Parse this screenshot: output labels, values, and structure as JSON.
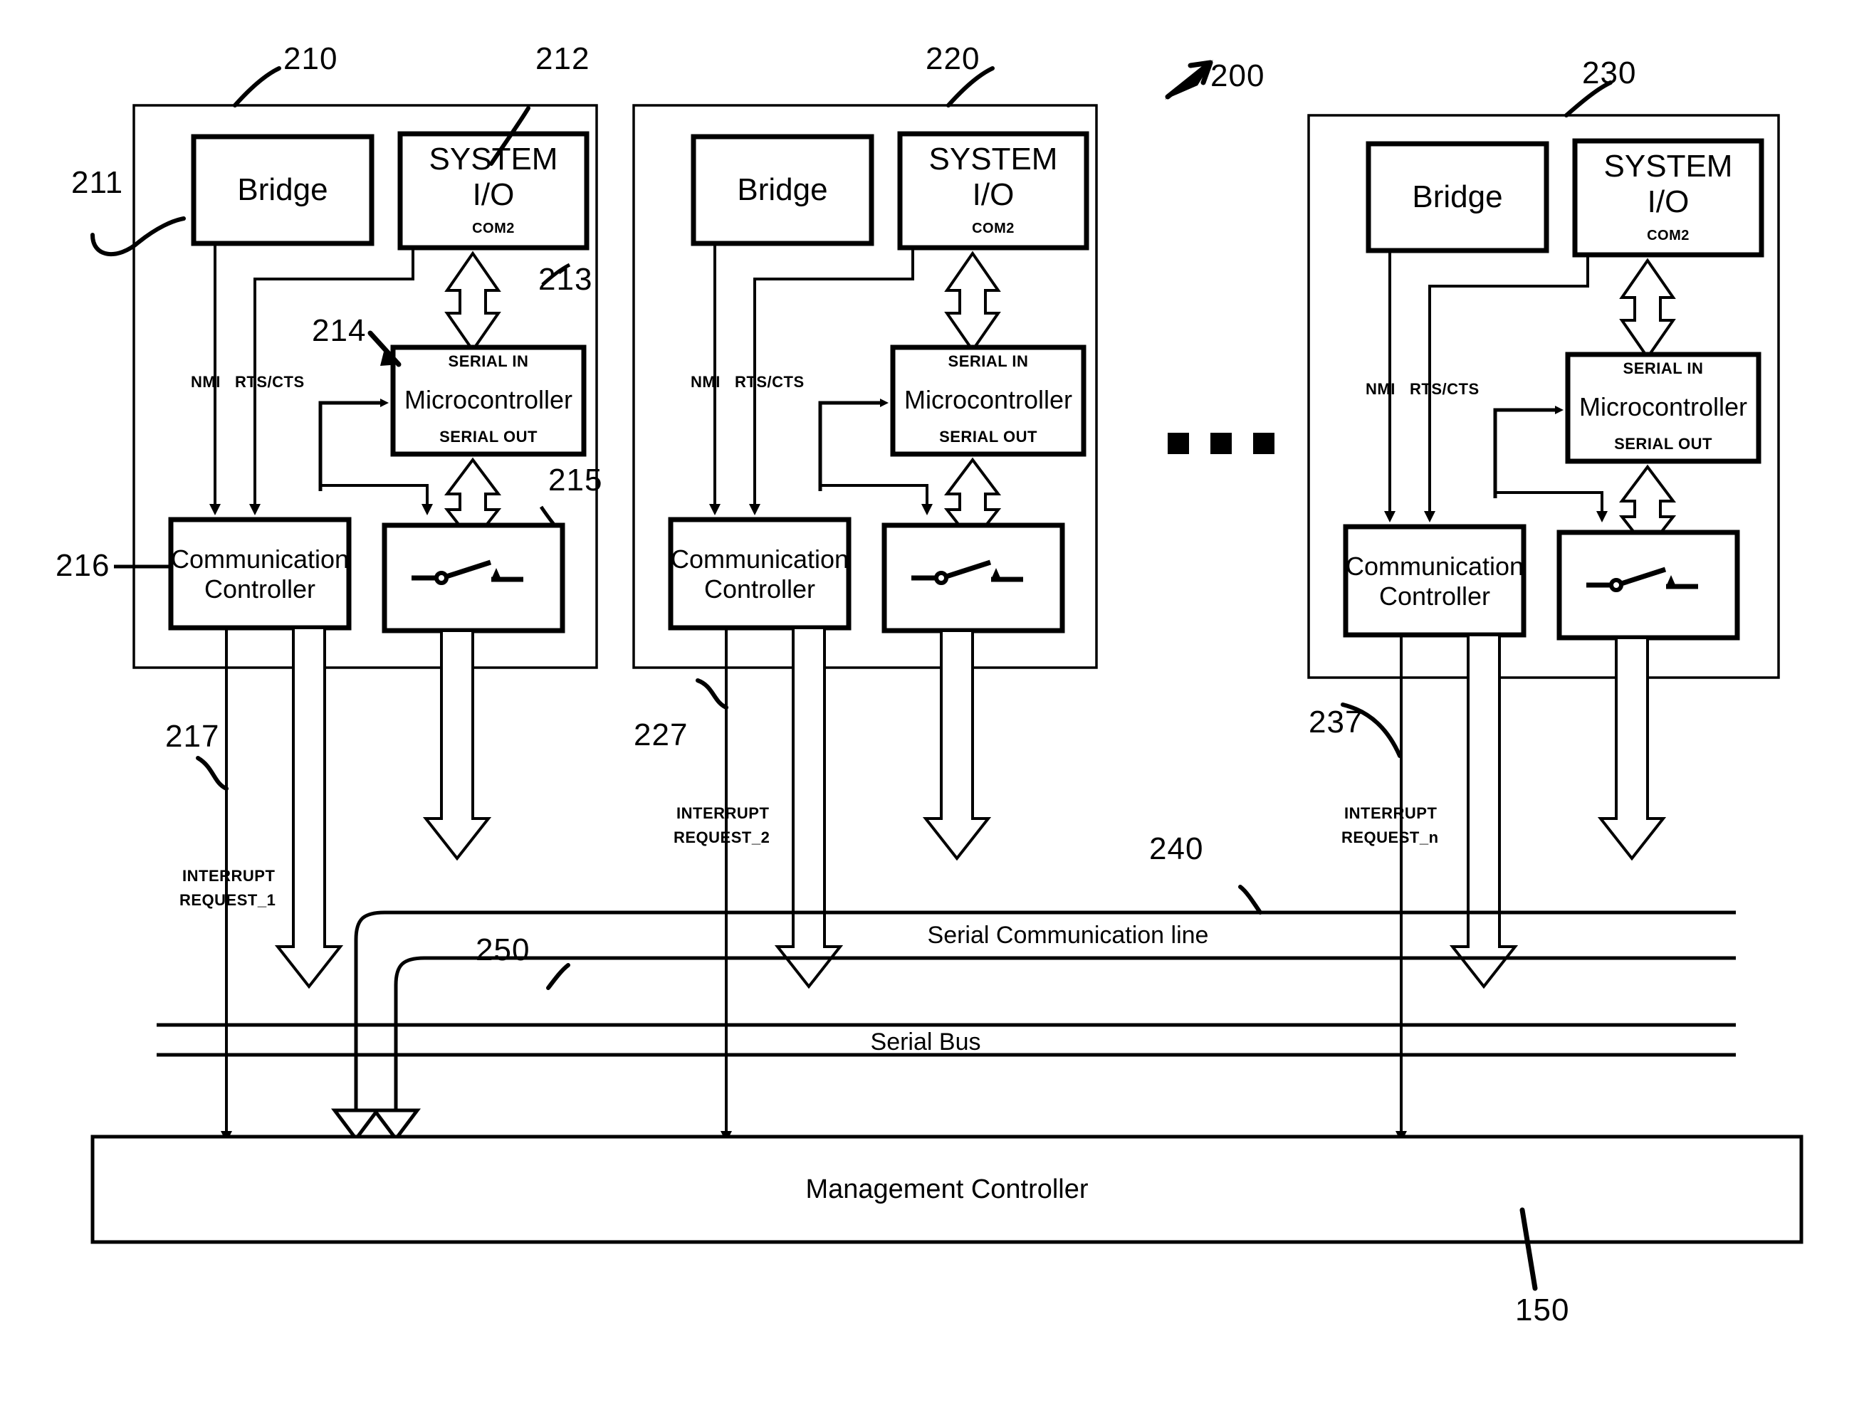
{
  "figure": {
    "id": "200",
    "title": "Server management block diagram",
    "ellipsis": "■ ■ ■"
  },
  "reference_numerals": {
    "system": "200",
    "node1_panel": "210",
    "node1_panel_edge": "211",
    "node1_system_io": "212",
    "node1_link_io_mcu": "213",
    "node1_microcontroller": "214",
    "node1_switch": "215",
    "node1_comm_controller": "216",
    "node1_interrupt": "217",
    "node2_panel": "220",
    "node2_interrupt": "227",
    "node3_panel": "230",
    "node3_interrupt": "237",
    "serial_comm_line": "240",
    "serial_bus": "250",
    "management_controller": "150"
  },
  "blocks": {
    "bridge": "Bridge",
    "system_io": "SYSTEM\nI/O",
    "system_io_line1": "SYSTEM",
    "system_io_line2": "I/O",
    "com_port": "COM2",
    "microcontroller": "Microcontroller",
    "serial_in": "SERIAL IN",
    "serial_out": "SERIAL OUT",
    "comm_controller_line1": "Communication",
    "comm_controller_line2": "Controller",
    "switch_symbol": "switch-icon",
    "management_controller": "Management  Controller"
  },
  "signals": {
    "nmi": "NMI",
    "rts_cts": "RTS/CTS",
    "interrupt_request_1_line1": "INTERRUPT",
    "interrupt_request_1_line2": "REQUEST_1",
    "interrupt_request_2_line1": "INTERRUPT",
    "interrupt_request_2_line2": "REQUEST_2",
    "interrupt_request_n_line1": "INTERRUPT",
    "interrupt_request_n_line2": "REQUEST_n"
  },
  "buses": {
    "serial_communication_line": "Serial Communication line",
    "serial_bus": "Serial Bus"
  },
  "colors": {
    "ink": "#000000",
    "paper": "#ffffff"
  }
}
